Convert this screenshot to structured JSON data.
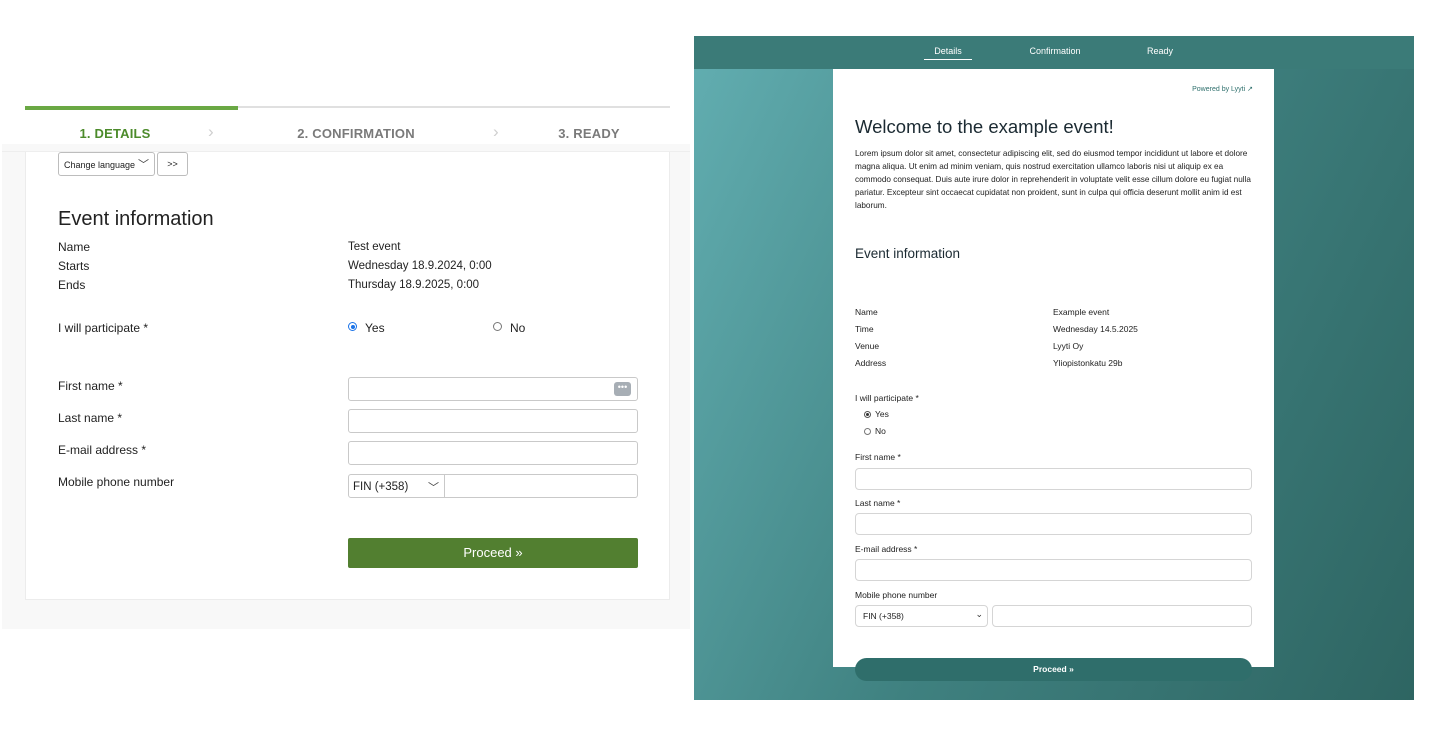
{
  "left": {
    "steps": [
      {
        "label": "1. DETAILS",
        "active": true
      },
      {
        "label": "2. CONFIRMATION",
        "active": false
      },
      {
        "label": "3. READY",
        "active": false
      }
    ],
    "language": {
      "select_label": "Change language",
      "go_label": ">>"
    },
    "section_title": "Event information",
    "info": [
      {
        "label": "Name",
        "value": "Test event"
      },
      {
        "label": "Starts",
        "value": "Wednesday 18.9.2024, 0:00"
      },
      {
        "label": "Ends",
        "value": "Thursday 18.9.2025, 0:00"
      }
    ],
    "participate": {
      "label": "I will participate *",
      "yes": "Yes",
      "no": "No",
      "selected": "Yes"
    },
    "fields": {
      "first_name": "First name *",
      "last_name": "Last name *",
      "email": "E-mail address *",
      "phone": "Mobile phone number",
      "phone_country": "FIN (+358)",
      "autofill_icon": "more-dots-icon"
    },
    "proceed": "Proceed »",
    "accent_color": "#527f30"
  },
  "right": {
    "nav": {
      "details": "Details",
      "confirmation": "Confirmation",
      "ready": "Ready",
      "active": "Details"
    },
    "powered_by": "Powered by Lyyti",
    "external_icon": "external-link-icon",
    "title": "Welcome to the example event!",
    "description": "Lorem ipsum dolor sit amet, consectetur adipiscing elit, sed do eiusmod tempor incididunt ut labore et dolore magna aliqua. Ut enim ad minim veniam, quis nostrud exercitation ullamco laboris nisi ut aliquip ex ea commodo consequat. Duis aute irure dolor in reprehenderit in voluptate velit esse cillum dolore eu fugiat nulla pariatur. Excepteur sint occaecat cupidatat non proident, sunt in culpa qui officia deserunt mollit anim id est laborum.",
    "section_title": "Event information",
    "info": [
      {
        "label": "Name",
        "value": "Example event"
      },
      {
        "label": "Time",
        "value": "Wednesday 14.5.2025"
      },
      {
        "label": "Venue",
        "value": "Lyyti Oy"
      },
      {
        "label": "Address",
        "value": "Yliopistonkatu 29b"
      }
    ],
    "participate": {
      "label": "I will participate *",
      "yes": "Yes",
      "no": "No",
      "selected": "Yes"
    },
    "fields": {
      "first_name": "First name *",
      "last_name": "Last name *",
      "email": "E-mail address *",
      "phone": "Mobile phone number",
      "phone_country": "FIN (+358)"
    },
    "proceed": "Proceed »",
    "accent_color": "#2f6e6b"
  }
}
